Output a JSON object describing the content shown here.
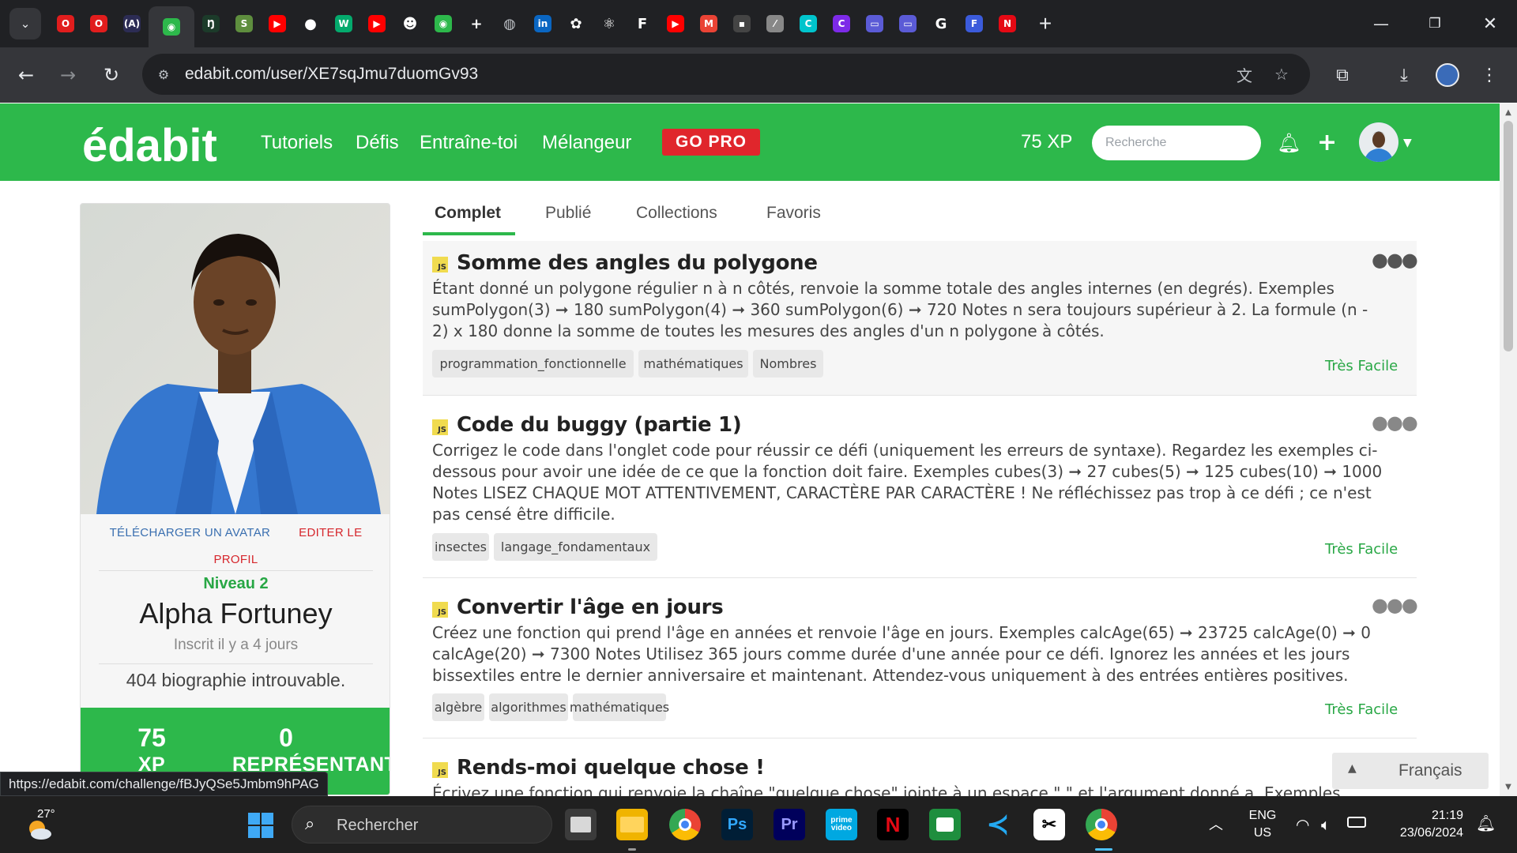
{
  "browser": {
    "tabs": [
      {
        "icon": "opera-icon",
        "color": "#e11d1d",
        "glyph": "O"
      },
      {
        "icon": "opera-icon",
        "color": "#e11d1d",
        "glyph": "O"
      },
      {
        "icon": "code-icon",
        "color": "#2c2c54",
        "glyph": "(A)"
      },
      {
        "icon": "edabit-icon",
        "color": "#2db84b",
        "glyph": "◉",
        "active": true
      },
      {
        "icon": "app-icon",
        "color": "#1c3b2a",
        "glyph": "Ŋ"
      },
      {
        "icon": "shopify-icon",
        "color": "#5e8e3e",
        "glyph": "S"
      },
      {
        "icon": "youtube-icon",
        "color": "#ff0000",
        "glyph": "▶"
      },
      {
        "icon": "github-icon",
        "color": "#ffffff",
        "glyph": "●"
      },
      {
        "icon": "w3schools-icon",
        "color": "#04aa6d",
        "glyph": "W"
      },
      {
        "icon": "youtube-icon",
        "color": "#ff0000",
        "glyph": "▶"
      },
      {
        "icon": "avatar-icon",
        "color": "#ffffff",
        "glyph": "☻"
      },
      {
        "icon": "edabit-icon",
        "color": "#2db84b",
        "glyph": "◉"
      },
      {
        "icon": "plus-tab-icon",
        "color": "#ffffff",
        "glyph": "+"
      },
      {
        "icon": "globe-icon",
        "color": "#bdc1c6",
        "glyph": "◍"
      },
      {
        "icon": "linkedin-icon",
        "color": "#0a66c2",
        "glyph": "in"
      },
      {
        "icon": "chatgpt-icon",
        "color": "#ffffff",
        "glyph": "✿"
      },
      {
        "icon": "react-icon",
        "color": "#ffffff",
        "glyph": "⚛"
      },
      {
        "icon": "f-icon",
        "color": "#ffffff",
        "glyph": "F"
      },
      {
        "icon": "youtube-icon",
        "color": "#ff0000",
        "glyph": "▶"
      },
      {
        "icon": "gmail-icon",
        "color": "#ea4335",
        "glyph": "M"
      },
      {
        "icon": "dark-icon",
        "color": "#444444",
        "glyph": "▪"
      },
      {
        "icon": "line-icon",
        "color": "#888888",
        "glyph": "⁄"
      },
      {
        "icon": "canva-icon",
        "color": "#00c4cc",
        "glyph": "C"
      },
      {
        "icon": "canva-icon",
        "color": "#7d2ae8",
        "glyph": "C"
      },
      {
        "icon": "slides-icon",
        "color": "#5b5bd6",
        "glyph": "▭"
      },
      {
        "icon": "slides-icon",
        "color": "#5b5bd6",
        "glyph": "▭"
      },
      {
        "icon": "google-icon",
        "color": "#ffffff",
        "glyph": "G"
      },
      {
        "icon": "forms-icon",
        "color": "#3b5bdb",
        "glyph": "F"
      },
      {
        "icon": "netflix-icon",
        "color": "#e50914",
        "glyph": "N"
      }
    ],
    "url": "edabit.com/user/XE7sqJmu7duomGv93",
    "status_url": "https://edabit.com/challenge/fBJyQSe5Jmbm9hPAG"
  },
  "header": {
    "logo": "édabit",
    "nav": [
      "Tutoriels",
      "Défis",
      "Entraîne-toi",
      "Mélangeur"
    ],
    "go_pro": "GO PRO",
    "xp": "75 XP",
    "search_placeholder": "Recherche"
  },
  "profile": {
    "upload_avatar": "TÉLÉCHARGER UN AVATAR",
    "edit_profile_1": "EDITER LE",
    "edit_profile_2": "PROFIL",
    "level": "Niveau 2",
    "name": "Alpha Fortuney",
    "joined": "Inscrit   il y a 4 jours",
    "bio": "404 biographie introuvable.",
    "stats": {
      "xp_value": "75",
      "xp_label": "XP",
      "rep_value": "0",
      "rep_label": "REPRÉSENTANT"
    }
  },
  "tabs": [
    "Complet",
    "Publié",
    "Collections",
    "Favoris"
  ],
  "challenges": [
    {
      "lang": "JS",
      "title": "Somme des angles du polygone",
      "description": "Étant donné un polygone régulier n à n côtés, renvoie la somme totale des angles internes (en degrés). Exemples sumPolygon(3) ➞ 180 sumPolygon(4) ➞ 360 sumPolygon(6) ➞ 720 Notes n sera toujours supérieur à 2. La formule (n - 2) x 180 donne la somme de toutes les mesures des angles d'un n polygone à côtés.",
      "tags": [
        "programmation_fonctionnelle",
        "mathématiques",
        "Nombres"
      ],
      "difficulty": "Très Facile"
    },
    {
      "lang": "JS",
      "title": "Code du buggy (partie 1)",
      "description": "Corrigez le code dans l'onglet code pour réussir ce défi (uniquement les erreurs de syntaxe). Regardez les exemples ci-dessous pour avoir une idée de ce que la fonction doit faire. Exemples cubes(3) ➞ 27 cubes(5) ➞ 125 cubes(10) ➞ 1000 Notes LISEZ CHAQUE MOT ATTENTIVEMENT, CARACTÈRE PAR CARACTÈRE ! Ne réfléchissez pas trop à ce défi ; ce n'est pas censé être difficile.",
      "tags": [
        "insectes",
        "langage_fondamentaux"
      ],
      "difficulty": "Très Facile"
    },
    {
      "lang": "JS",
      "title": "Convertir l'âge en jours",
      "description": "Créez une fonction qui prend l'âge en années et renvoie l'âge en jours. Exemples calcAge(65) ➞ 23725 calcAge(0) ➞ 0 calcAge(20) ➞ 7300 Notes Utilisez 365 jours comme durée d'une année pour ce défi. Ignorez les années et les jours bissextiles entre le dernier anniversaire et maintenant. Attendez-vous uniquement à des entrées entières positives.",
      "tags": [
        "algèbre",
        "algorithmes",
        "mathématiques"
      ],
      "difficulty": "Très Facile"
    },
    {
      "lang": "JS",
      "title": "Rends-moi quelque chose !",
      "description": "Écrivez une fonction qui renvoie la chaîne \"quelque chose\" jointe à un espace \" \" et l'argument donné a. Exemples"
    }
  ],
  "language_switch": "Français",
  "taskbar": {
    "weather_temp": "27°",
    "search_label": "Rechercher",
    "lang_line1": "ENG",
    "lang_line2": "US",
    "time": "21:19",
    "date": "23/06/2024"
  },
  "colors": {
    "brand_green": "#2db84b",
    "go_pro_red": "#e0262c",
    "difficulty_green": "#28a745",
    "js_yellow": "#f0db4f"
  }
}
